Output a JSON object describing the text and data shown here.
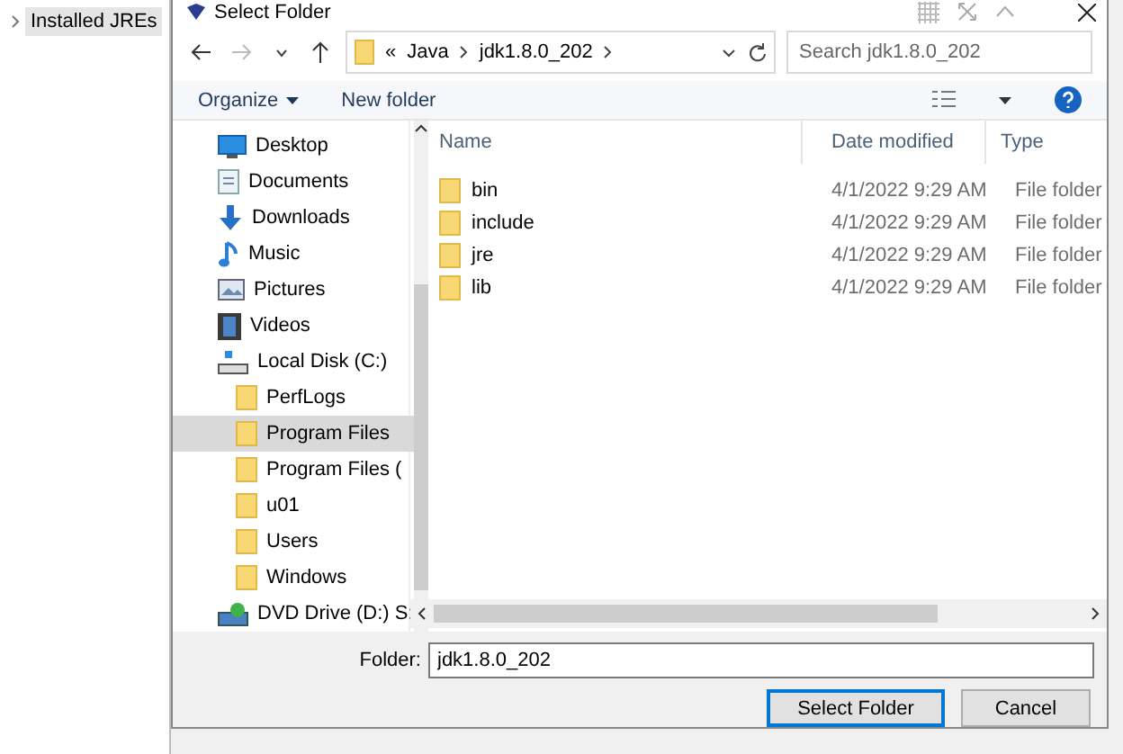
{
  "background_window": {
    "tree_item": "Installed JREs"
  },
  "dialog": {
    "title": "Select Folder",
    "breadcrumb": {
      "overflow": "«",
      "segments": [
        "Java",
        "jdk1.8.0_202"
      ]
    },
    "search": {
      "placeholder": "Search jdk1.8.0_202"
    },
    "toolbar": {
      "organize": "Organize",
      "new_folder": "New folder"
    },
    "nav": [
      {
        "label": "Desktop",
        "kind": "desktop",
        "selected": false
      },
      {
        "label": "Documents",
        "kind": "documents",
        "selected": false
      },
      {
        "label": "Downloads",
        "kind": "downloads",
        "selected": false
      },
      {
        "label": "Music",
        "kind": "music",
        "selected": false
      },
      {
        "label": "Pictures",
        "kind": "pictures",
        "selected": false
      },
      {
        "label": "Videos",
        "kind": "videos",
        "selected": false
      },
      {
        "label": "Local Disk (C:)",
        "kind": "drive",
        "selected": false,
        "children": [
          {
            "label": "PerfLogs",
            "kind": "folder",
            "selected": false
          },
          {
            "label": "Program Files",
            "kind": "folder",
            "selected": true
          },
          {
            "label": "Program Files (",
            "kind": "folder",
            "selected": false
          },
          {
            "label": "u01",
            "kind": "folder",
            "selected": false
          },
          {
            "label": "Users",
            "kind": "folder",
            "selected": false
          },
          {
            "label": "Windows",
            "kind": "folder",
            "selected": false
          }
        ]
      },
      {
        "label": "DVD Drive (D:) S:",
        "kind": "dvd",
        "selected": false
      }
    ],
    "columns": [
      "Name",
      "Date modified",
      "Type"
    ],
    "rows": [
      {
        "name": "bin",
        "date": "4/1/2022 9:29 AM",
        "type": "File folder"
      },
      {
        "name": "include",
        "date": "4/1/2022 9:29 AM",
        "type": "File folder"
      },
      {
        "name": "jre",
        "date": "4/1/2022 9:29 AM",
        "type": "File folder"
      },
      {
        "name": "lib",
        "date": "4/1/2022 9:29 AM",
        "type": "File folder"
      }
    ],
    "folder_field": {
      "label": "Folder:",
      "value": "jdk1.8.0_202"
    },
    "buttons": [
      "Select Folder",
      "Cancel"
    ]
  }
}
